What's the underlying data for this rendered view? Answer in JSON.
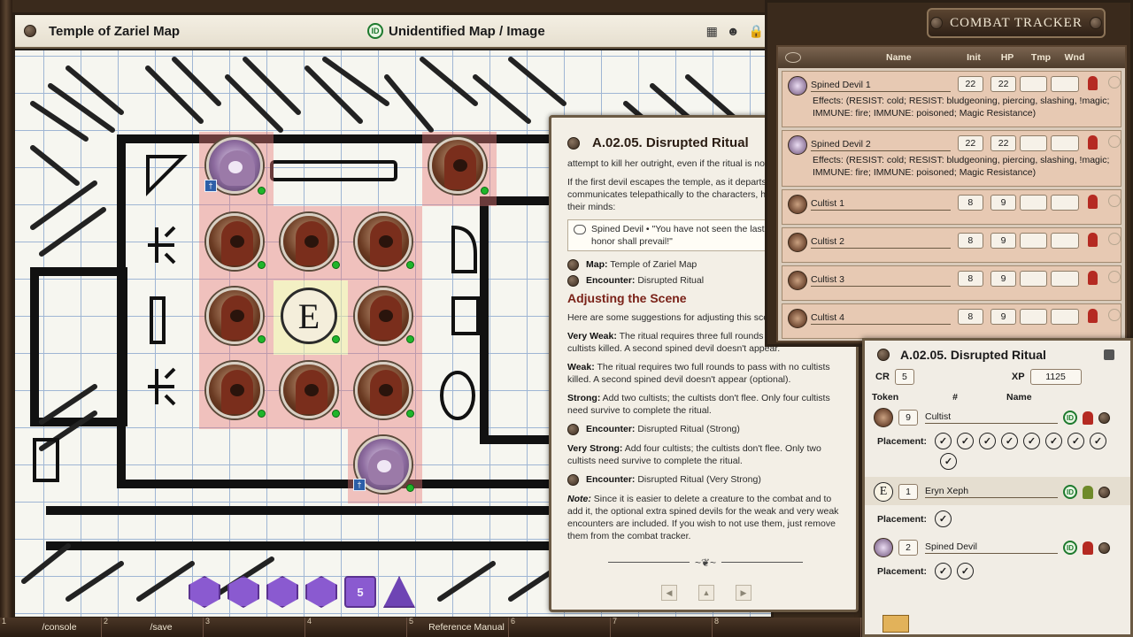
{
  "map": {
    "title": "Temple of Zariel Map",
    "id_badge": "ID",
    "subtitle": "Unidentified Map / Image",
    "token_e_letter": "E",
    "token_badge": "†",
    "dice": [
      "",
      "",
      "",
      "",
      "5",
      ""
    ]
  },
  "story": {
    "title": "A.02.05. Disrupted Ritual",
    "p1": "attempt to kill her outright, even if the ritual is not yet complete.",
    "p2": "If the first devil escapes the temple, as it departs, Zariel communicates telepathically to the characters, her voice invading their minds:",
    "quote_speaker": "Spined Devil",
    "quote_text": "\"You have not seen the last of Zariel! Her honor shall prevail!\"",
    "link_map_label": "Map:",
    "link_map_value": "Temple of Zariel Map",
    "link_enc_label": "Encounter:",
    "link_enc_value": "Disrupted Ritual",
    "heading": "Adjusting the Scene",
    "intro": "Here are some suggestions for adjusting this scene:",
    "very_weak_label": "Very Weak:",
    "very_weak_text": "The ritual requires three full rounds to pass with no cultists killed. A second spined devil doesn't appear.",
    "weak_label": "Weak:",
    "weak_text": "The ritual requires two full rounds to pass with no cultists killed. A second spined devil doesn't appear (optional).",
    "strong_label": "Strong:",
    "strong_text": "Add two cultists; the cultists don't flee. Only four cultists need survive to complete the ritual.",
    "strong_link_label": "Encounter:",
    "strong_link_value": "Disrupted Ritual (Strong)",
    "very_strong_label": "Very Strong:",
    "very_strong_text": "Add four cultists; the cultists don't flee. Only two cultists need survive to complete the ritual.",
    "very_strong_link_label": "Encounter:",
    "very_strong_link_value": "Disrupted Ritual (Very Strong)",
    "note_label": "Note:",
    "note_text": "Since it is easier to delete a creature to the combat and to add it, the optional extra spined devils for the weak and very weak encounters are included. If you wish to not use them, just remove them from the combat tracker.",
    "ornament": "~❦~",
    "nav_prev": "◀",
    "nav_up": "▲",
    "nav_next": "▶"
  },
  "combat": {
    "title": "COMBAT TRACKER",
    "headers": {
      "name": "Name",
      "init": "Init",
      "hp": "HP",
      "tmp": "Tmp",
      "wnd": "Wnd"
    },
    "rows": [
      {
        "name": "Spined Devil 1",
        "init": "22",
        "hp": "22",
        "effects": "Effects: (RESIST: cold; RESIST: bludgeoning, piercing, slashing, !magic; IMMUNE: fire; IMMUNE: poisoned; Magic Resistance)"
      },
      {
        "name": "Spined Devil 2",
        "init": "22",
        "hp": "22",
        "effects": "Effects: (RESIST: cold; RESIST: bludgeoning, piercing, slashing, !magic; IMMUNE: fire; IMMUNE: poisoned; Magic Resistance)"
      },
      {
        "name": "Cultist 1",
        "init": "8",
        "hp": "9"
      },
      {
        "name": "Cultist 2",
        "init": "8",
        "hp": "9"
      },
      {
        "name": "Cultist 3",
        "init": "8",
        "hp": "9"
      },
      {
        "name": "Cultist 4",
        "init": "8",
        "hp": "9"
      }
    ]
  },
  "encounter": {
    "title": "A.02.05. Disrupted Ritual",
    "cr_label": "CR",
    "cr_value": "5",
    "xp_label": "XP",
    "xp_value": "1125",
    "col_token": "Token",
    "col_count": "#",
    "col_name": "Name",
    "placement_label": "Placement:",
    "id_badge": "ID",
    "check_mark": "✓",
    "token_e_letter": "E",
    "rows": [
      {
        "count": "9",
        "name": "Cultist"
      },
      {
        "count": "1",
        "name": "Eryn Xeph"
      },
      {
        "count": "2",
        "name": "Spined Devil"
      }
    ]
  },
  "hotkeys": [
    {
      "num": "1",
      "label": "/console"
    },
    {
      "num": "2",
      "label": "/save"
    },
    {
      "num": "3",
      "label": ""
    },
    {
      "num": "4",
      "label": ""
    },
    {
      "num": "5",
      "label": "Reference Manual"
    },
    {
      "num": "6",
      "label": ""
    },
    {
      "num": "7",
      "label": ""
    },
    {
      "num": "8",
      "label": ""
    }
  ]
}
